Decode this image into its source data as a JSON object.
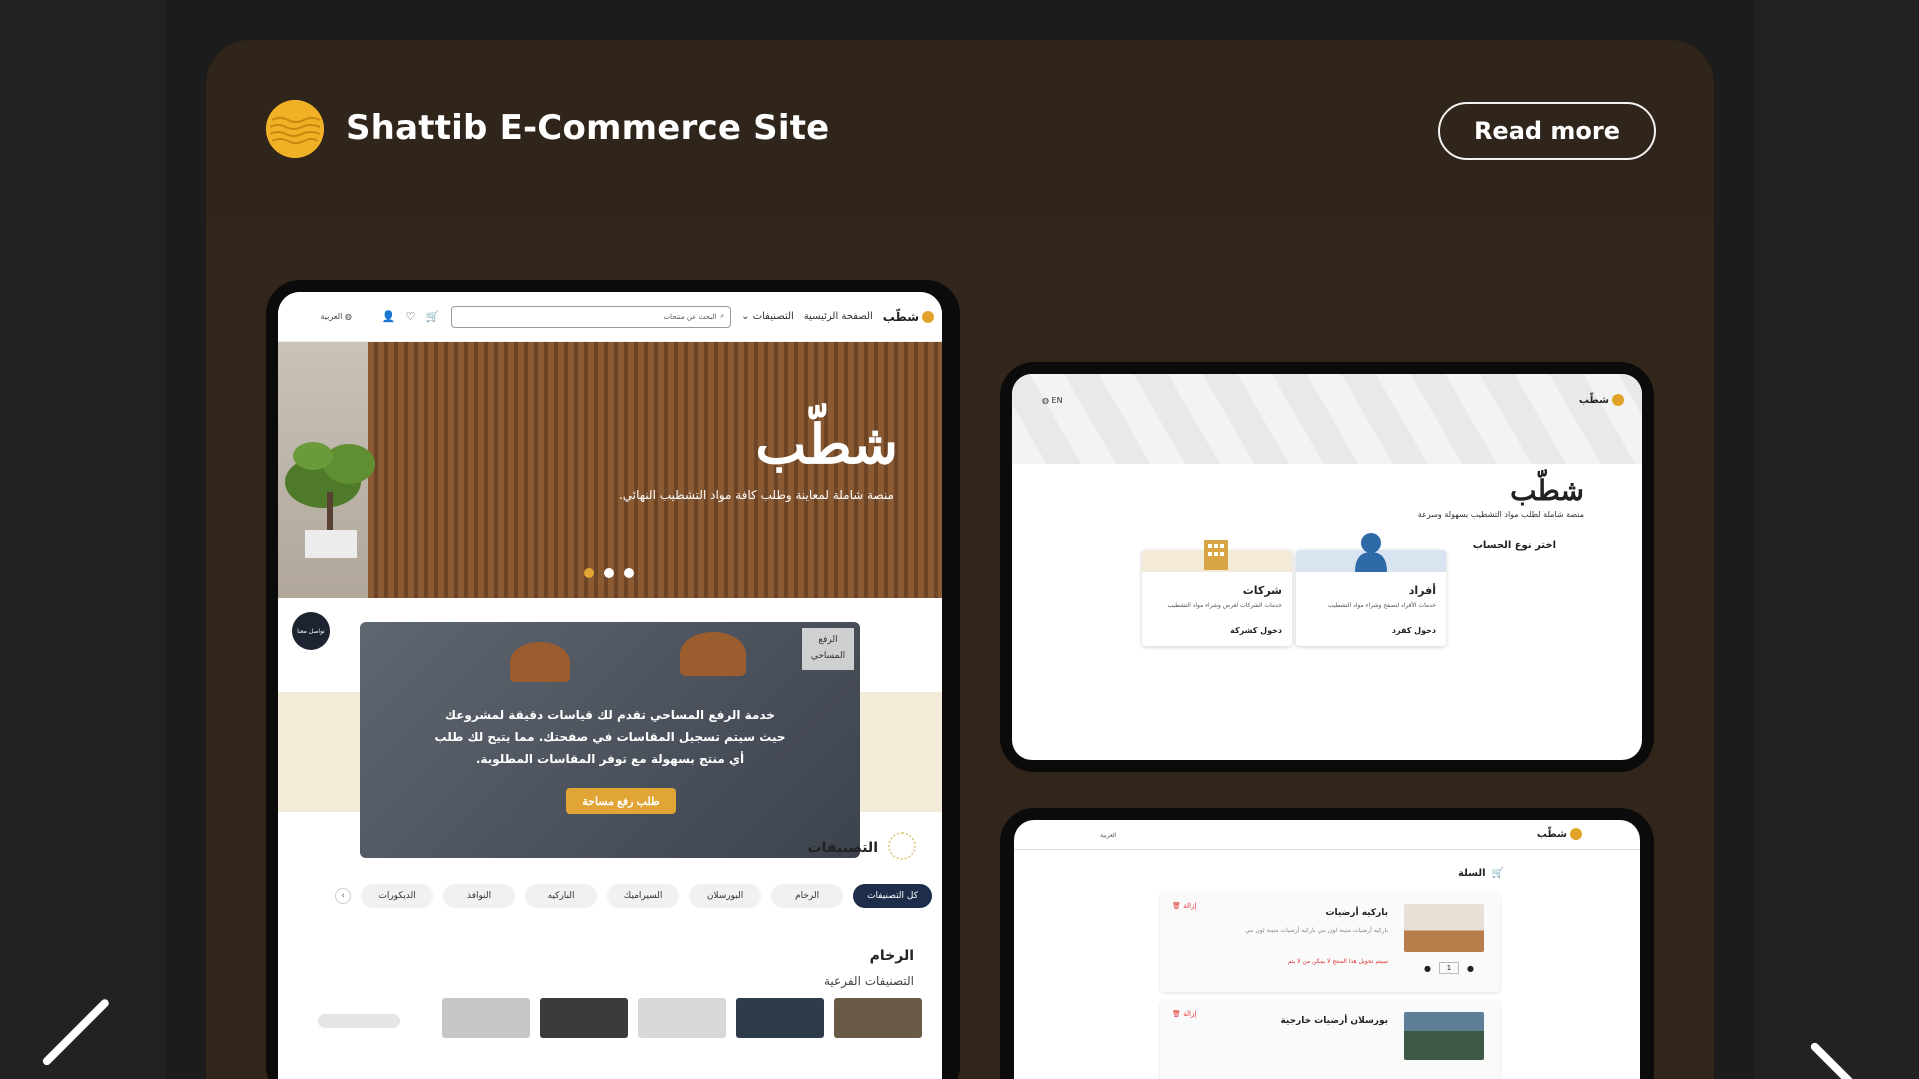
{
  "card": {
    "title": "Shattib E-Commerce Site",
    "read_more": "Read more",
    "accent_color": "#f0b127"
  },
  "tablet1": {
    "nav": {
      "brand": "شطّب",
      "home": "الصفحة الرئيسية",
      "categories": "التصنيفات",
      "search_placeholder": "البحث عن منتجات",
      "lang": "العربية",
      "icons": [
        "cart-icon",
        "heart-icon",
        "user-icon",
        "globe-icon"
      ]
    },
    "hero": {
      "title": "شطّب",
      "subtitle": "منصة شاملة لمعاينة وطلب كافة مواد التشطيب النهائي."
    },
    "contact": "تواصل معنا",
    "promo": {
      "tag": "الرفع المساحي",
      "text": "خدمة الرفع المساحي تقدم لك قياسات دقيقة لمشروعك حيث سيتم تسجيل المقاسات في صفحتك. مما يتيح لك طلب أي منتج بسهولة مع توفر المقاسات المطلوبة.",
      "button": "طلب رفع مساحة"
    },
    "categories_title": "التصنيفات",
    "pills": [
      "كل التصنيفات",
      "الرخام",
      "البورسلان",
      "السيراميك",
      "الباركيه",
      "النوافذ",
      "الديكورات"
    ],
    "section_title": "الرخام",
    "section_sub": "التصنيفات الفرعية"
  },
  "tablet2": {
    "brand": "شطّب",
    "lang": "EN",
    "title": "شطّب",
    "subtitle": "منصة شاملة لطلب مواد التشطيب بسهولة وسرعة",
    "choose": "اختر نوع الحساب",
    "accounts": [
      {
        "name": "أفراد",
        "desc": "خدمات الأفراد لتصفح وشراء مواد التشطيب",
        "link": "دخول كفرد"
      },
      {
        "name": "شركات",
        "desc": "خدمات الشركات لعرض وشراء مواد التشطيب",
        "link": "دخول كشركة"
      }
    ]
  },
  "tablet3": {
    "brand": "شطّب",
    "lang": "العربية",
    "cart_title": "السلة",
    "items": [
      {
        "title": "باركيه أرضيات",
        "desc": "باركيه أرضيات متينة لون بني باركيه أرضيات متينة لون بني",
        "warning": "سيتم تحويل هذا المنتج لا يمكن من لا يتم",
        "delete": "إزالة",
        "qty": "1"
      },
      {
        "title": "بورسلان أرضيات خارجية",
        "delete": "إزالة"
      }
    ]
  }
}
